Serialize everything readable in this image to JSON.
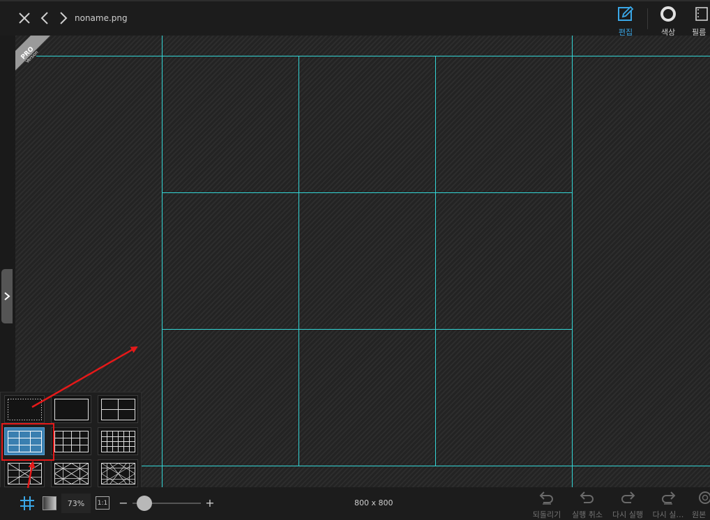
{
  "header": {
    "filename": "noname.png",
    "tools": [
      {
        "label": "편집",
        "icon": "edit-icon",
        "active": true
      },
      {
        "label": "색상",
        "icon": "color-ring-icon",
        "active": false
      },
      {
        "label": "필름",
        "icon": "film-icon",
        "active": false
      }
    ]
  },
  "badge": {
    "line1": "PRO",
    "line2": "Version"
  },
  "grid_popup": {
    "options": [
      "none",
      "border",
      "2x2",
      "3x3",
      "4x3",
      "5x3",
      "x-cross",
      "x-grid",
      "x-grid-dense"
    ],
    "selected": "3x3"
  },
  "footer": {
    "zoom": "73%",
    "one_to_one": "1:1",
    "zoom_minus": "−",
    "zoom_plus": "+",
    "zoom_level": 0.13,
    "image_size": "800 x 800",
    "history": [
      {
        "label": "되돌리기",
        "icon": "undo-all-icon"
      },
      {
        "label": "실행 취소",
        "icon": "undo-icon"
      },
      {
        "label": "다시 실행",
        "icon": "redo-icon"
      },
      {
        "label": "다시 실…",
        "icon": "redo-all-icon"
      },
      {
        "label": "원본",
        "icon": "original-icon"
      }
    ]
  },
  "colors": {
    "guide": "#33d6d6",
    "accent": "#3aa8e8",
    "annotation": "#e51919"
  }
}
